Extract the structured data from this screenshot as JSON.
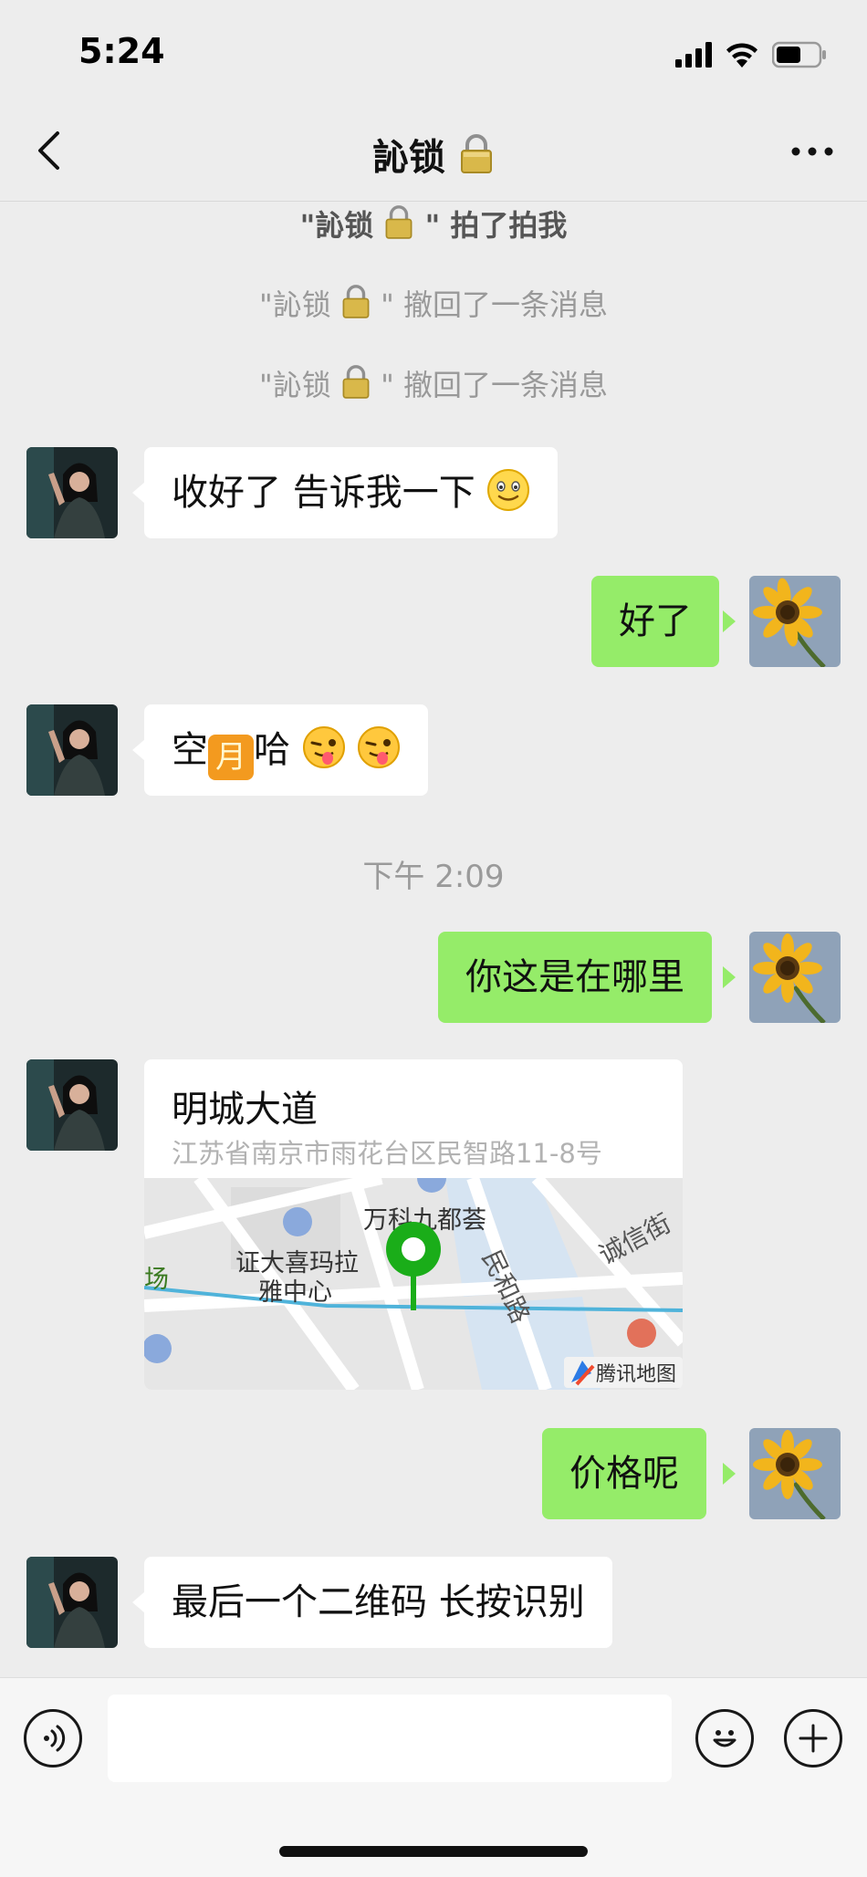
{
  "status_bar": {
    "time": "5:24"
  },
  "nav": {
    "title": "訫锁"
  },
  "system_messages": {
    "pat": [
      "\"訫锁",
      "\" 拍了拍我"
    ],
    "recall_1": [
      "\"訫锁",
      "\" 撤回了一条消息"
    ],
    "recall_2": [
      "\"訫锁",
      "\" 撤回了一条消息"
    ]
  },
  "messages": {
    "m1": {
      "text": "收好了 告诉我一下"
    },
    "m2": {
      "text": "好了"
    },
    "m3": {
      "pre": "空",
      "mid": "月",
      "post": "哈"
    },
    "timestamp": "下午 2:09",
    "m4": {
      "text": "你这是在哪里"
    },
    "location": {
      "name": "明城大道",
      "address": "江苏省南京市雨花台区民智路11-8号",
      "map_labels": {
        "poi_1": "万科九都荟",
        "poi_2a": "证大喜玛拉",
        "poi_2b": "雅中心",
        "road_1": "民和路",
        "road_2": "诚信街",
        "edge": "场",
        "watermark": "腾讯地图"
      }
    },
    "m5": {
      "text": "价格呢"
    },
    "m6": {
      "text": "最后一个二维码 长按识别"
    }
  },
  "colors": {
    "background": "#ededed",
    "outgoing_bubble": "#95ec69",
    "incoming_bubble": "#ffffff",
    "map_pin": "#1aad19"
  },
  "icons": [
    "back-icon",
    "more-icon",
    "lock-icon",
    "voice-icon",
    "emoji-icon",
    "plus-icon"
  ]
}
